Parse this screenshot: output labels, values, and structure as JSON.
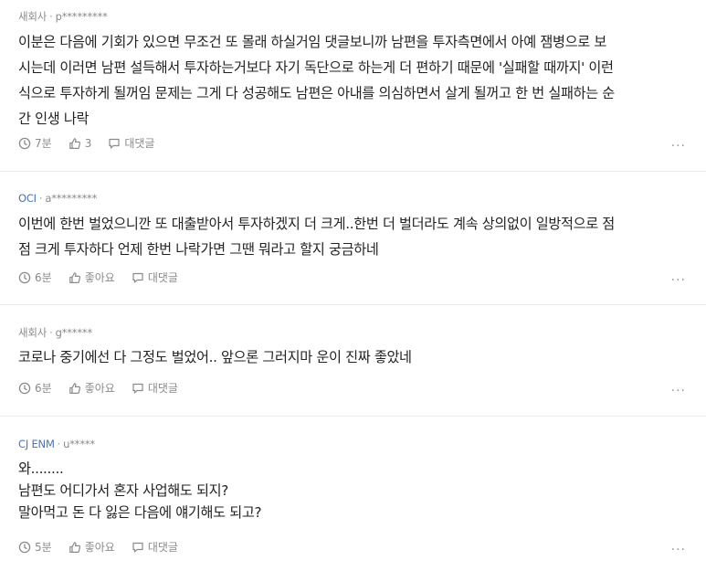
{
  "comments": [
    {
      "company": "새회사",
      "author": "p*********",
      "lines": [
        "이분은 다음에 기회가 있으면 무조건 또 몰래 하실거임 댓글보니까 남편을 투자측면에서 아예 잼병으로 보",
        "시는데 이러면 남편 설득해서 투자하는거보다 자기 독단으로 하는게 더 편하기 때문에 '실패할 때까지' 이런",
        "식으로 투자하게 될꺼임 문제는 그게 다 성공해도 남편은 아내를 의심하면서 살게 될꺼고 한 번 실패하는 순",
        "간 인생 나락"
      ],
      "time": "7분",
      "likes": "3",
      "reply": "대댓글"
    },
    {
      "company": "OCI",
      "author": "a*********",
      "lines": [
        "이번에 한번 벌었으니깐 또 대출받아서 투자하겠지 더 크게..한번 더 벌더라도 계속 상의없이 일방적으로 점",
        "점 크게 투자하다 언제 한번 나락가면 그땐 뭐라고 할지 궁금하네"
      ],
      "time": "6분",
      "likes": "좋아요",
      "reply": "대댓글"
    },
    {
      "company": "새회사",
      "author": "g******",
      "lines": [
        "코로나 중기에선 다 그정도 벌었어.. 앞으론 그러지마 운이 진짜 좋았네"
      ],
      "time": "6분",
      "likes": "좋아요",
      "reply": "대댓글"
    },
    {
      "company": "CJ ENM",
      "author": "u*****",
      "lines": [
        "와........",
        "남편도 어디가서 혼자 사업해도 되지?",
        "말아먹고 돈 다 잃은 다음에 얘기해도 되고?"
      ],
      "time": "5분",
      "likes": "좋아요",
      "reply": "대댓글"
    }
  ],
  "icons": {
    "time": "clock-icon",
    "like": "thumbs-up-icon",
    "reply": "speech-bubble-icon",
    "more": "more-dots-icon"
  },
  "colors": {
    "text": "#222222",
    "meta": "#8a8a8a",
    "company_link": "#4a73b8",
    "divider": "#ebebeb"
  },
  "more_label": "···",
  "meta_separator": "·"
}
